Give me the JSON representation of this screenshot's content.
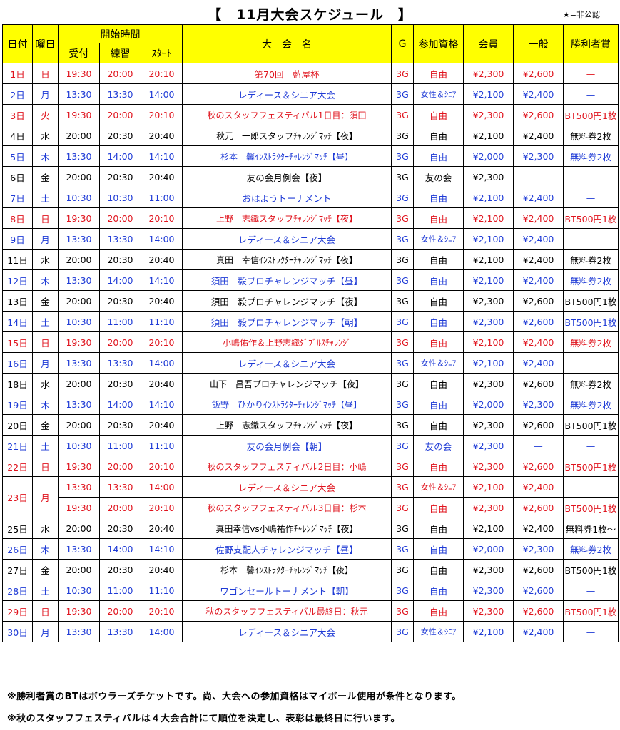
{
  "title": "【　11月大会スケジュール　】",
  "star_note": "★=非公認",
  "headers": {
    "date": "日付",
    "weekday": "曜日",
    "start_time": "開始時間",
    "reception": "受付",
    "practice": "練習",
    "start": "ｽﾀｰﾄ",
    "name": "大　会　名",
    "games": "G",
    "qualification": "参加資格",
    "member": "会員",
    "general": "一般",
    "prize": "勝利者賞"
  },
  "rows": [
    {
      "date": "1日",
      "weekday": "日",
      "reception": "19:30",
      "practice": "20:00",
      "start": "20:10",
      "name": "第70回　藍屋杯",
      "games": "3G",
      "qual": "自由",
      "member": "¥2,300",
      "general": "¥2,600",
      "prize": "—",
      "color": "red"
    },
    {
      "date": "2日",
      "weekday": "月",
      "reception": "13:30",
      "practice": "13:30",
      "start": "14:00",
      "name": "レディース＆シニア大会",
      "games": "3G",
      "qual": "女性＆ｼﾆｱ",
      "member": "¥2,100",
      "general": "¥2,400",
      "prize": "—",
      "color": "blue"
    },
    {
      "date": "3日",
      "weekday": "火",
      "reception": "19:30",
      "practice": "20:00",
      "start": "20:10",
      "name": "秋のスタッフフェスティバル1日目：須田",
      "games": "3G",
      "qual": "自由",
      "member": "¥2,300",
      "general": "¥2,600",
      "prize": "BT500円1枚",
      "color": "red"
    },
    {
      "date": "4日",
      "weekday": "水",
      "reception": "20:00",
      "practice": "20:30",
      "start": "20:40",
      "name": "秋元　一郎スタッフﾁｬﾚﾝｼﾞﾏｯﾁ【夜】",
      "games": "3G",
      "qual": "自由",
      "member": "¥2,100",
      "general": "¥2,400",
      "prize": "無料券2枚",
      "color": "black"
    },
    {
      "date": "5日",
      "weekday": "木",
      "reception": "13:30",
      "practice": "14:00",
      "start": "14:10",
      "name": "杉本　馨ｲﾝｽﾄﾗｸﾀｰﾁｬﾚﾝｼﾞﾏｯﾁ【昼】",
      "games": "3G",
      "qual": "自由",
      "member": "¥2,000",
      "general": "¥2,300",
      "prize": "無料券2枚",
      "color": "blue"
    },
    {
      "date": "6日",
      "weekday": "金",
      "reception": "20:00",
      "practice": "20:30",
      "start": "20:40",
      "name": "友の会月例会【夜】",
      "games": "3G",
      "qual": "友の会",
      "member": "¥2,300",
      "general": "—",
      "prize": "—",
      "color": "black"
    },
    {
      "date": "7日",
      "weekday": "土",
      "reception": "10:30",
      "practice": "10:30",
      "start": "11:00",
      "name": "おはようトーナメント",
      "games": "3G",
      "qual": "自由",
      "member": "¥2,100",
      "general": "¥2,400",
      "prize": "—",
      "color": "blue"
    },
    {
      "date": "8日",
      "weekday": "日",
      "reception": "19:30",
      "practice": "20:00",
      "start": "20:10",
      "name": "上野　志織スタッフﾁｬﾚﾝｼﾞﾏｯﾁ【夜】",
      "games": "3G",
      "qual": "自由",
      "member": "¥2,100",
      "general": "¥2,400",
      "prize": "BT500円1枚",
      "color": "red"
    },
    {
      "date": "9日",
      "weekday": "月",
      "reception": "13:30",
      "practice": "13:30",
      "start": "14:00",
      "name": "レディース＆シニア大会",
      "games": "3G",
      "qual": "女性＆ｼﾆｱ",
      "member": "¥2,100",
      "general": "¥2,400",
      "prize": "—",
      "color": "blue"
    },
    {
      "date": "11日",
      "weekday": "水",
      "reception": "20:00",
      "practice": "20:30",
      "start": "20:40",
      "name": "真田　幸信ｲﾝｽﾄﾗｸﾀｰﾁｬﾚﾝｼﾞﾏｯﾁ【夜】",
      "games": "3G",
      "qual": "自由",
      "member": "¥2,100",
      "general": "¥2,400",
      "prize": "無料券2枚",
      "color": "black"
    },
    {
      "date": "12日",
      "weekday": "木",
      "reception": "13:30",
      "practice": "14:00",
      "start": "14:10",
      "name": "須田　毅プロチャレンジマッチ【昼】",
      "games": "3G",
      "qual": "自由",
      "member": "¥2,100",
      "general": "¥2,400",
      "prize": "無料券2枚",
      "color": "blue"
    },
    {
      "date": "13日",
      "weekday": "金",
      "reception": "20:00",
      "practice": "20:30",
      "start": "20:40",
      "name": "須田　毅プロチャレンジマッチ【夜】",
      "games": "3G",
      "qual": "自由",
      "member": "¥2,300",
      "general": "¥2,600",
      "prize": "BT500円1枚",
      "color": "black"
    },
    {
      "date": "14日",
      "weekday": "土",
      "reception": "10:30",
      "practice": "11:00",
      "start": "11:10",
      "name": "須田　毅プロチャレンジマッチ【朝】",
      "games": "3G",
      "qual": "自由",
      "member": "¥2,300",
      "general": "¥2,600",
      "prize": "BT500円1枚",
      "color": "blue"
    },
    {
      "date": "15日",
      "weekday": "日",
      "reception": "19:30",
      "practice": "20:00",
      "start": "20:10",
      "name": "小嶋佑作＆上野志織ﾀﾞﾌﾞﾙｽﾁｬﾚﾝｼﾞ",
      "games": "3G",
      "qual": "自由",
      "member": "¥2,100",
      "general": "¥2,400",
      "prize": "無料券2枚",
      "color": "red"
    },
    {
      "date": "16日",
      "weekday": "月",
      "reception": "13:30",
      "practice": "13:30",
      "start": "14:00",
      "name": "レディース＆シニア大会",
      "games": "3G",
      "qual": "女性＆ｼﾆｱ",
      "member": "¥2,100",
      "general": "¥2,400",
      "prize": "—",
      "color": "blue"
    },
    {
      "date": "18日",
      "weekday": "水",
      "reception": "20:00",
      "practice": "20:30",
      "start": "20:40",
      "name": "山下　昌吾プロチャレンジマッチ【夜】",
      "games": "3G",
      "qual": "自由",
      "member": "¥2,300",
      "general": "¥2,600",
      "prize": "無料券2枚",
      "color": "black"
    },
    {
      "date": "19日",
      "weekday": "木",
      "reception": "13:30",
      "practice": "14:00",
      "start": "14:10",
      "name": "飯野　ひかりｲﾝｽﾄﾗｸﾀｰﾁｬﾚﾝｼﾞﾏｯﾁ【昼】",
      "games": "3G",
      "qual": "自由",
      "member": "¥2,000",
      "general": "¥2,300",
      "prize": "無料券2枚",
      "color": "blue"
    },
    {
      "date": "20日",
      "weekday": "金",
      "reception": "20:00",
      "practice": "20:30",
      "start": "20:40",
      "name": "上野　志織スタッフﾁｬﾚﾝｼﾞﾏｯﾁ【夜】",
      "games": "3G",
      "qual": "自由",
      "member": "¥2,300",
      "general": "¥2,600",
      "prize": "BT500円1枚",
      "color": "black"
    },
    {
      "date": "21日",
      "weekday": "土",
      "reception": "10:30",
      "practice": "11:00",
      "start": "11:10",
      "name": "友の会月例会【朝】",
      "games": "3G",
      "qual": "友の会",
      "member": "¥2,300",
      "general": "—",
      "prize": "—",
      "color": "blue"
    },
    {
      "date": "22日",
      "weekday": "日",
      "reception": "19:30",
      "practice": "20:00",
      "start": "20:10",
      "name": "秋のスタッフフェスティバル2日目：小嶋",
      "games": "3G",
      "qual": "自由",
      "member": "¥2,300",
      "general": "¥2,600",
      "prize": "BT500円1枚",
      "color": "red"
    },
    {
      "date": "23日",
      "weekday": "月",
      "reception": "13:30",
      "practice": "13:30",
      "start": "14:00",
      "name": "レディース＆シニア大会",
      "games": "3G",
      "qual": "女性＆ｼﾆｱ",
      "member": "¥2,100",
      "general": "¥2,400",
      "prize": "—",
      "color": "red",
      "span_start": true
    },
    {
      "reception": "19:30",
      "practice": "20:00",
      "start": "20:10",
      "name": "秋のスタッフフェスティバル3日目：杉本",
      "games": "3G",
      "qual": "自由",
      "member": "¥2,300",
      "general": "¥2,600",
      "prize": "BT500円1枚",
      "color": "red",
      "span_cont": true
    },
    {
      "date": "25日",
      "weekday": "水",
      "reception": "20:00",
      "practice": "20:30",
      "start": "20:40",
      "name": "真田幸信vs小嶋祐作ﾁｬﾚﾝｼﾞﾏｯﾁ【夜】",
      "games": "3G",
      "qual": "自由",
      "member": "¥2,100",
      "general": "¥2,400",
      "prize": "無料券1枚～",
      "color": "black"
    },
    {
      "date": "26日",
      "weekday": "木",
      "reception": "13:30",
      "practice": "14:00",
      "start": "14:10",
      "name": "佐野支配人チャレンジマッチ【昼】",
      "games": "3G",
      "qual": "自由",
      "member": "¥2,000",
      "general": "¥2,300",
      "prize": "無料券2枚",
      "color": "blue"
    },
    {
      "date": "27日",
      "weekday": "金",
      "reception": "20:00",
      "practice": "20:30",
      "start": "20:40",
      "name": "杉本　馨ｲﾝｽﾄﾗｸﾀｰﾁｬﾚﾝｼﾞﾏｯﾁ【夜】",
      "games": "3G",
      "qual": "自由",
      "member": "¥2,300",
      "general": "¥2,600",
      "prize": "BT500円1枚",
      "color": "black"
    },
    {
      "date": "28日",
      "weekday": "土",
      "reception": "10:30",
      "practice": "11:00",
      "start": "11:10",
      "name": "ワゴンセールトーナメント【朝】",
      "games": "3G",
      "qual": "自由",
      "member": "¥2,300",
      "general": "¥2,600",
      "prize": "—",
      "color": "blue"
    },
    {
      "date": "29日",
      "weekday": "日",
      "reception": "19:30",
      "practice": "20:00",
      "start": "20:10",
      "name": "秋のスタッフフェスティバル最終日：秋元",
      "games": "3G",
      "qual": "自由",
      "member": "¥2,300",
      "general": "¥2,600",
      "prize": "BT500円1枚",
      "color": "red"
    },
    {
      "date": "30日",
      "weekday": "月",
      "reception": "13:30",
      "practice": "13:30",
      "start": "14:00",
      "name": "レディース＆シニア大会",
      "games": "3G",
      "qual": "女性＆ｼﾆｱ",
      "member": "¥2,100",
      "general": "¥2,400",
      "prize": "—",
      "color": "blue"
    }
  ],
  "footnotes": [
    "※勝利者賞のBTはボウラーズチケットです。尚、大会への参加資格はマイボール使用が条件となります。",
    "※秋のスタッフフェスティバルは４大会合計にて順位を決定し、表彰は最終日に行います。"
  ],
  "colors": {
    "red": "#e0141e",
    "blue": "#1f3bd6",
    "header_bg": "#ffff00"
  }
}
